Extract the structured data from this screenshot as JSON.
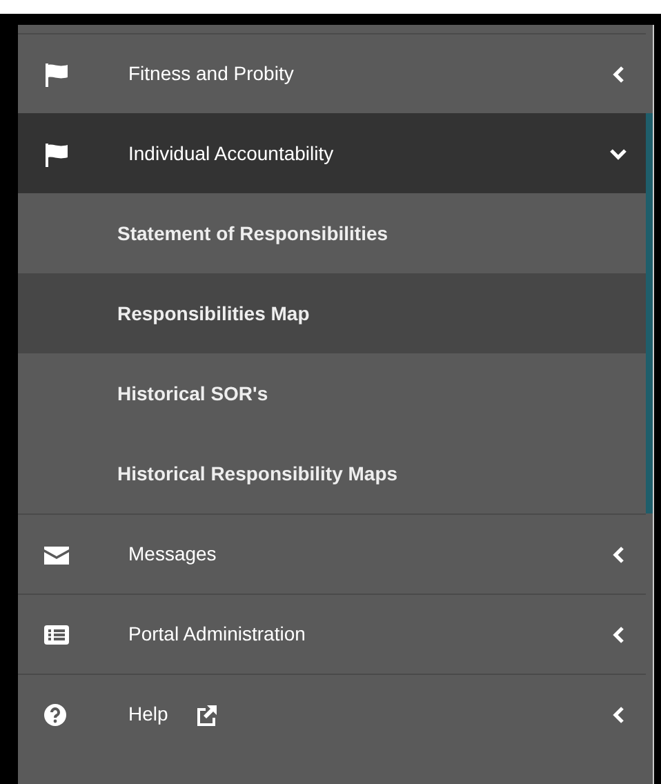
{
  "menu": [
    {
      "label": "Fitness and Probity",
      "expanded": false,
      "external": false
    },
    {
      "label": "Individual Accountability",
      "expanded": true,
      "external": false,
      "children": [
        {
          "label": "Statement of Responsibilities",
          "selected": false
        },
        {
          "label": "Responsibilities Map",
          "selected": true
        },
        {
          "label": "Historical SOR's",
          "selected": false
        },
        {
          "label": "Historical Responsibility Maps",
          "selected": false
        }
      ]
    },
    {
      "label": "Messages",
      "expanded": false,
      "external": false
    },
    {
      "label": "Portal Administration",
      "expanded": false,
      "external": false
    },
    {
      "label": "Help",
      "expanded": false,
      "external": true
    }
  ]
}
